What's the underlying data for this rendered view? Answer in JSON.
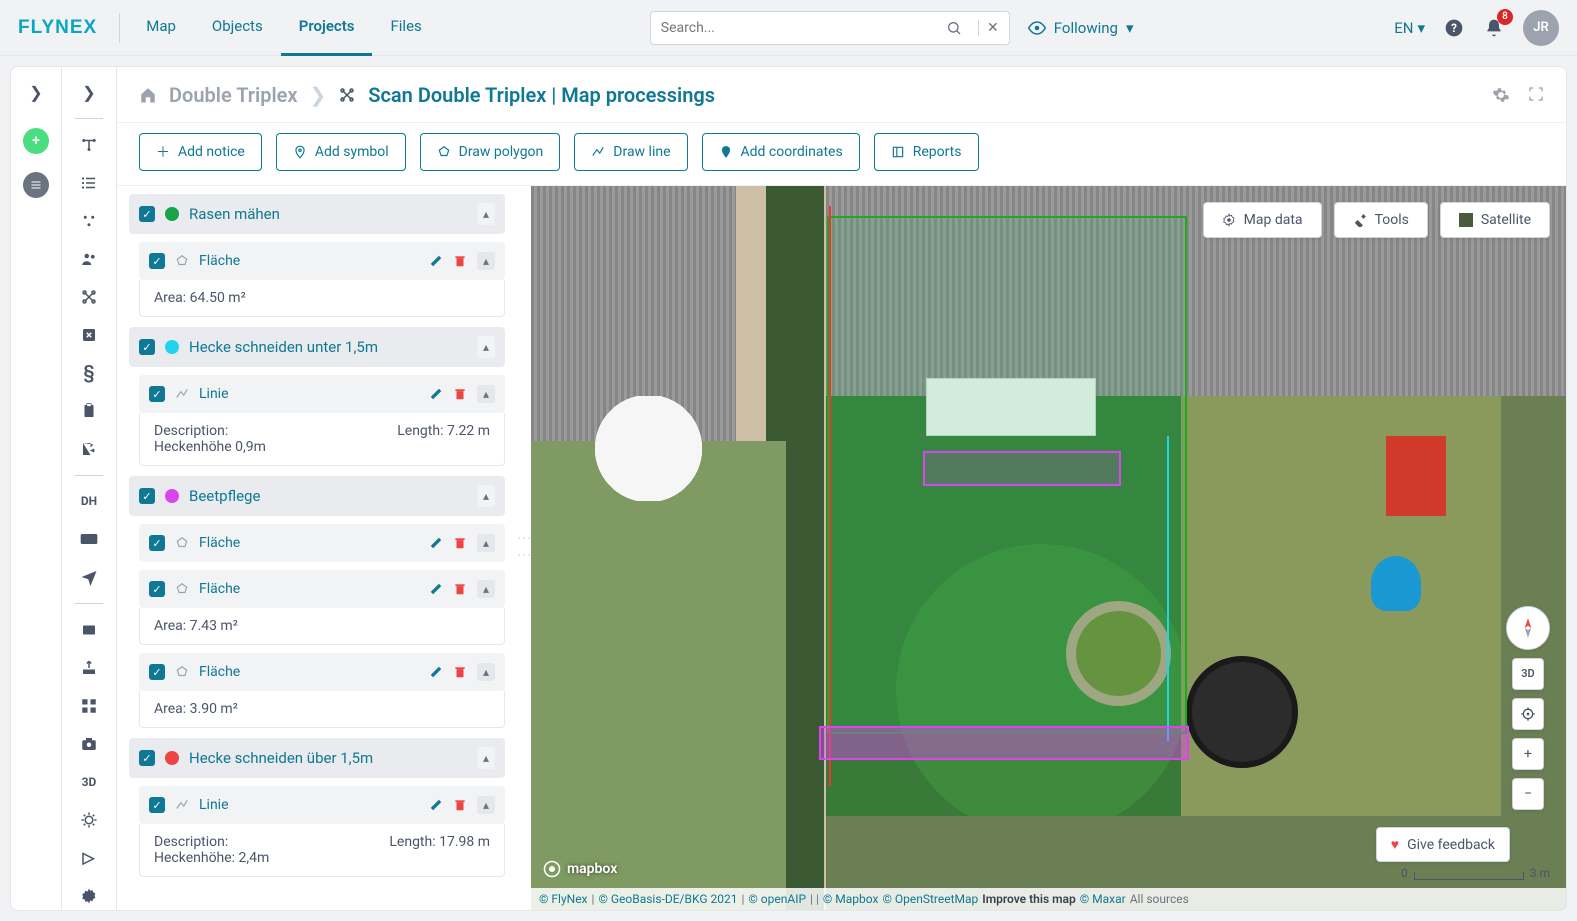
{
  "nav": {
    "logo": "FLYNEX",
    "tabs": {
      "map": "Map",
      "objects": "Objects",
      "projects": "Projects",
      "files": "Files"
    },
    "search_placeholder": "Search...",
    "following": "Following",
    "lang": "EN",
    "badge": "8",
    "avatar": "JR"
  },
  "rail": {
    "dh": "DH",
    "threed": "3D"
  },
  "breadcrumb": {
    "parent": "Double Triplex",
    "title": "Scan Double Triplex | Map processings"
  },
  "actions": {
    "notice": "Add notice",
    "symbol": "Add symbol",
    "polygon": "Draw polygon",
    "line": "Draw line",
    "coords": "Add coordinates",
    "reports": "Reports"
  },
  "groups": [
    {
      "name": "Rasen mähen",
      "color": "#16a34a",
      "items": [
        {
          "shape": "poly",
          "label": "Fläche",
          "body": {
            "left": "Area: 64.50 m²"
          }
        }
      ]
    },
    {
      "name": "Hecke schneiden unter 1,5m",
      "color": "#22d3ee",
      "items": [
        {
          "shape": "line",
          "label": "Linie",
          "body": {
            "leftTop": "Description:",
            "leftBottom": "Heckenhöhe 0,9m",
            "right": "Length: 7.22 m"
          }
        }
      ]
    },
    {
      "name": "Beetpflege",
      "color": "#d946ef",
      "items": [
        {
          "shape": "poly",
          "label": "Fläche"
        },
        {
          "shape": "poly",
          "label": "Fläche",
          "body": {
            "left": "Area: 7.43 m²"
          }
        },
        {
          "shape": "poly",
          "label": "Fläche",
          "body": {
            "left": "Area: 3.90 m²"
          }
        }
      ]
    },
    {
      "name": "Hecke schneiden über 1,5m",
      "color": "#ef4444",
      "items": [
        {
          "shape": "line",
          "label": "Linie",
          "body": {
            "leftTop": "Description:",
            "leftBottom": "Heckenhöhe: 2,4m",
            "right": "Length: 17.98 m"
          }
        }
      ]
    }
  ],
  "map": {
    "buttons": {
      "mapdata": "Map data",
      "tools": "Tools",
      "satellite": "Satellite"
    },
    "threed": "3D",
    "feedback": "Give feedback",
    "mapbox": "mapbox",
    "scale": {
      "left": "0",
      "right": "3 m"
    },
    "attrib": {
      "flynex": "© FlyNex",
      "geo": "© GeoBasis-DE/BKG 2021",
      "openaip": "© openAIP",
      "mapbox": "© Mapbox",
      "osm": "© OpenStreetMap",
      "improve": "Improve this map",
      "maxar": "© Maxar",
      "all": "All sources"
    }
  }
}
